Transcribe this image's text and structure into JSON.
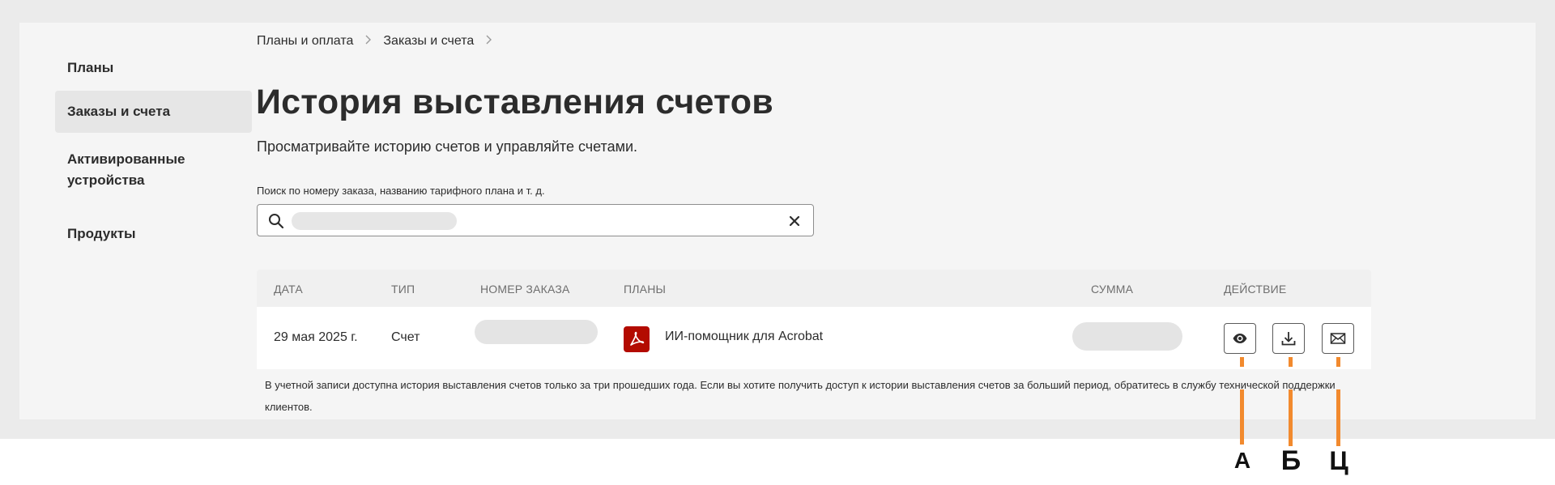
{
  "sidebar": {
    "items": [
      {
        "label": "Планы",
        "active": false
      },
      {
        "label": "Заказы и счета",
        "active": true
      },
      {
        "label": "Активированные устройства",
        "active": false
      },
      {
        "label": "Продукты",
        "active": false
      }
    ]
  },
  "breadcrumb": {
    "items": [
      "Планы и оплата",
      "Заказы и счета"
    ],
    "separator_icon": "chevron-right-icon"
  },
  "page": {
    "title": "История выставления счетов",
    "subtitle": "Просматривайте историю счетов и управляйте счетами."
  },
  "search": {
    "label": "Поиск по номеру заказа, названию тарифного плана и т. д.",
    "value": "",
    "value_redacted": true,
    "icon": "search-icon",
    "clear_icon": "close-icon"
  },
  "table": {
    "headers": {
      "date": "ДАТА",
      "type": "ТИП",
      "order_number": "НОМЕР ЗАКАЗА",
      "plans": "ПЛАНЫ",
      "amount": "СУММА",
      "action": "ДЕЙСТВИЕ"
    },
    "rows": [
      {
        "date": "29 мая 2025 г.",
        "type": "Счет",
        "order_number_redacted": true,
        "plan_icon": "acrobat-pdf-icon",
        "plan": "ИИ-помощник для Acrobat",
        "amount_redacted": true,
        "actions": [
          "view-icon",
          "download-icon",
          "email-icon"
        ]
      }
    ]
  },
  "notice": "В учетной записи доступна история выставления счетов только за три прошедших года. Если вы хотите получить доступ к истории выставления счетов за больший период, обратитесь в службу технической поддержки клиентов.",
  "annotations": {
    "letters": [
      "А",
      "Б",
      "Ц"
    ],
    "color": "#f28a2e"
  },
  "colors": {
    "acrobat_red": "#b30b00",
    "panel_bg": "#f5f5f5",
    "active_item_bg": "#e6e6e6"
  }
}
